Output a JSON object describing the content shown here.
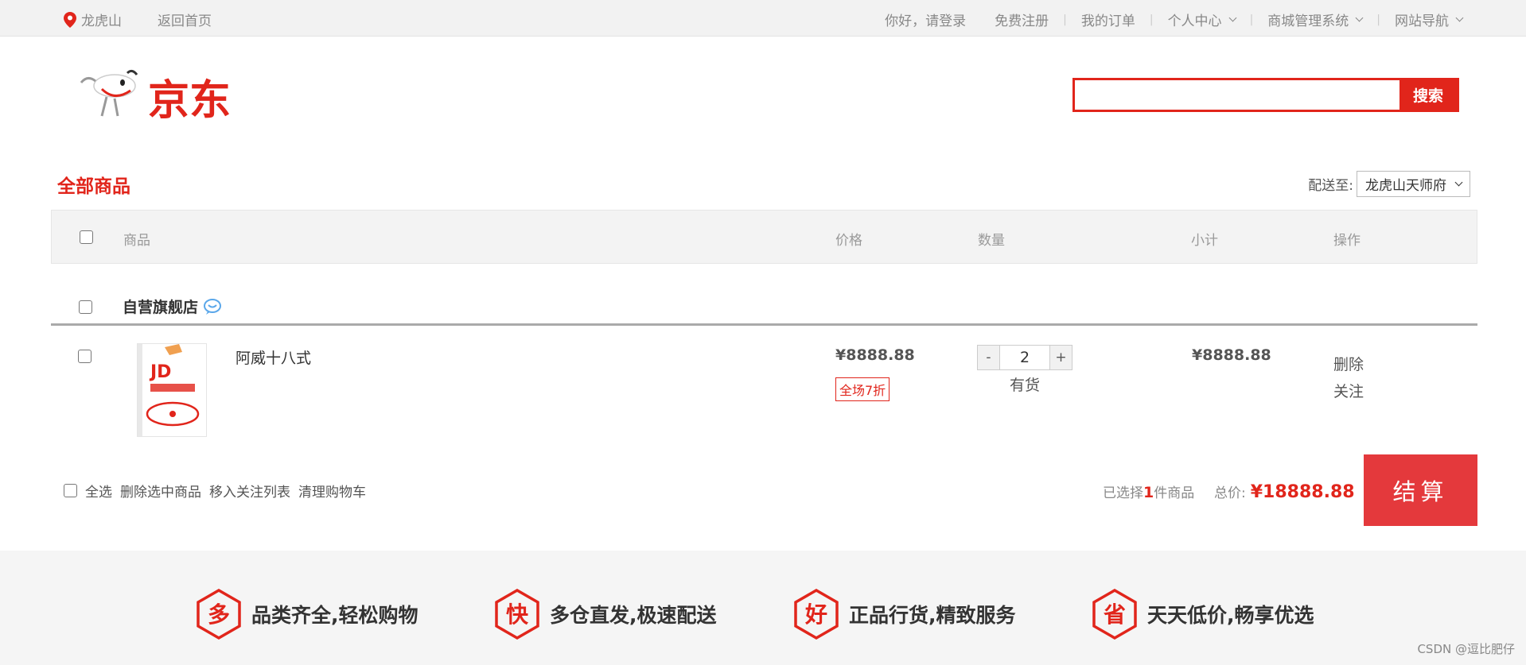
{
  "topbar": {
    "location": "龙虎山",
    "home": "返回首页",
    "login": "你好，请登录",
    "register": "免费注册",
    "orders": "我的订单",
    "personal": "个人中心",
    "mall_admin": "商城管理系统",
    "site_nav": "网站导航",
    "separator": "|"
  },
  "logo": {
    "text": "京东"
  },
  "search": {
    "button": "搜索",
    "value": ""
  },
  "cart": {
    "title": "全部商品",
    "ship_label": "配送至:",
    "ship_value": "龙虎山天师府",
    "columns": {
      "product": "商品",
      "price": "价格",
      "qty": "数量",
      "subtotal": "小计",
      "ops": "操作"
    },
    "shop_name": "自营旗舰店",
    "item": {
      "name": "阿威十八式",
      "price": "¥8888.88",
      "promo": "全场7折",
      "qty_minus": "-",
      "qty": "2",
      "qty_plus": "+",
      "stock": "有货",
      "subtotal": "¥8888.88",
      "op_delete": "删除",
      "op_follow": "关注"
    },
    "bottom": {
      "select_all": "全选",
      "delete_selected": "删除选中商品",
      "move_follow": "移入关注列表",
      "clear": "清理购物车",
      "selected_prefix": "已选择",
      "selected_count": "1",
      "selected_suffix": "件商品",
      "total_label": "总价:",
      "total_value": "¥18888.88",
      "checkout": "结算"
    }
  },
  "footer": {
    "features": [
      {
        "icon": "多",
        "text": "品类齐全,轻松购物"
      },
      {
        "icon": "快",
        "text": "多仓直发,极速配送"
      },
      {
        "icon": "好",
        "text": "正品行货,精致服务"
      },
      {
        "icon": "省",
        "text": "天天低价,畅享优选"
      }
    ],
    "credit": "CSDN @逗比肥仔"
  },
  "colors": {
    "brand_red": "#e1251b",
    "checkout_red": "#e4393c"
  }
}
